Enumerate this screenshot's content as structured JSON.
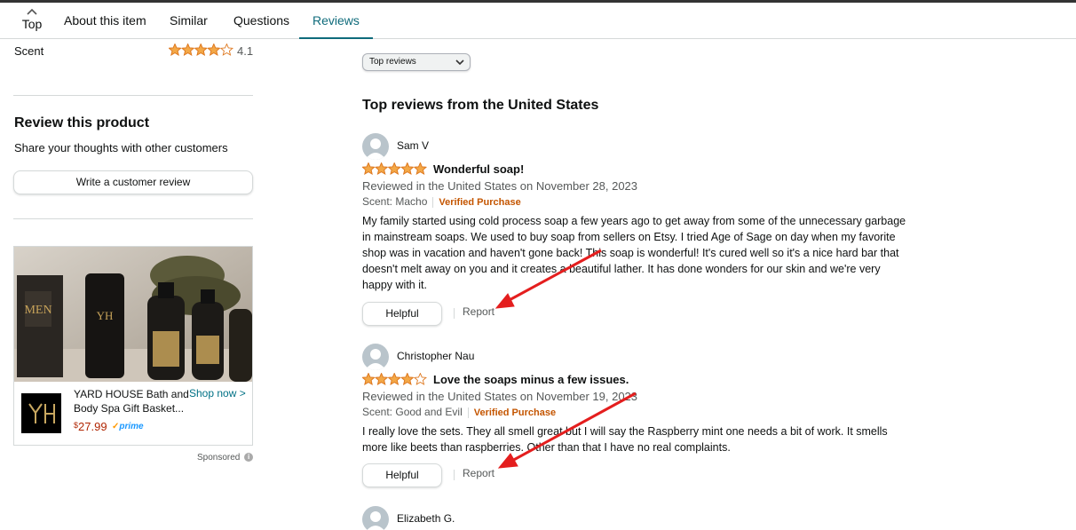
{
  "tabs": {
    "top_label": "Top",
    "items": [
      {
        "label": "About this item"
      },
      {
        "label": "Similar"
      },
      {
        "label": "Questions"
      },
      {
        "label": "Reviews"
      }
    ],
    "active": "Reviews"
  },
  "sidebar": {
    "scent_label": "Scent",
    "scent_rating": "4.1",
    "scent_stars": 4.1,
    "review_heading": "Review this product",
    "review_sub": "Share your thoughts with other customers",
    "write_button": "Write a customer review"
  },
  "ad": {
    "title": "YARD HOUSE Bath and Body Spa Gift Basket...",
    "shop_now": "Shop now >",
    "price_symbol": "$",
    "price": "27.99",
    "prime": "prime",
    "sponsored": "Sponsored",
    "logo_text": "YH"
  },
  "main": {
    "sort_label": "Top reviews",
    "heading": "Top reviews from the United States"
  },
  "reviews": [
    {
      "name": "Sam V",
      "stars": 5,
      "title": "Wonderful soap!",
      "date": "Reviewed in the United States on November 28, 2023",
      "scent": "Scent: Macho",
      "verified": "Verified Purchase",
      "body": "My family started using cold process soap a few years ago to get away from some of the unnecessary garbage in mainstream soaps. We used to buy soap from sellers on Etsy. I tried Age of Sage on day when my favorite shop was in vacation and haven't gone back! This soap is wonderful! It's cured well so it's a nice hard bar that doesn't melt away on you and it creates a beautiful lather. It has done wonders for our skin and we're very happy with it.",
      "helpful": "Helpful",
      "report": "Report"
    },
    {
      "name": "Christopher Nau",
      "stars": 4,
      "title": "Love the soaps minus a few issues.",
      "date": "Reviewed in the United States on November 19, 2023",
      "scent": "Scent: Good and Evil",
      "verified": "Verified Purchase",
      "body": "I really love the sets. They all smell great but I will say the Raspberry mint one needs a bit of work. It smells more like beets than raspberries. Other than that I have no real complaints.",
      "helpful": "Helpful",
      "report": "Report"
    },
    {
      "name": "Elizabeth G."
    }
  ],
  "colors": {
    "star": "#f3a847",
    "link": "#007185",
    "tab_active": "#0f6b7b",
    "verified": "#c45500",
    "price": "#b12704",
    "annotation_arrow": "#e41e1e"
  }
}
